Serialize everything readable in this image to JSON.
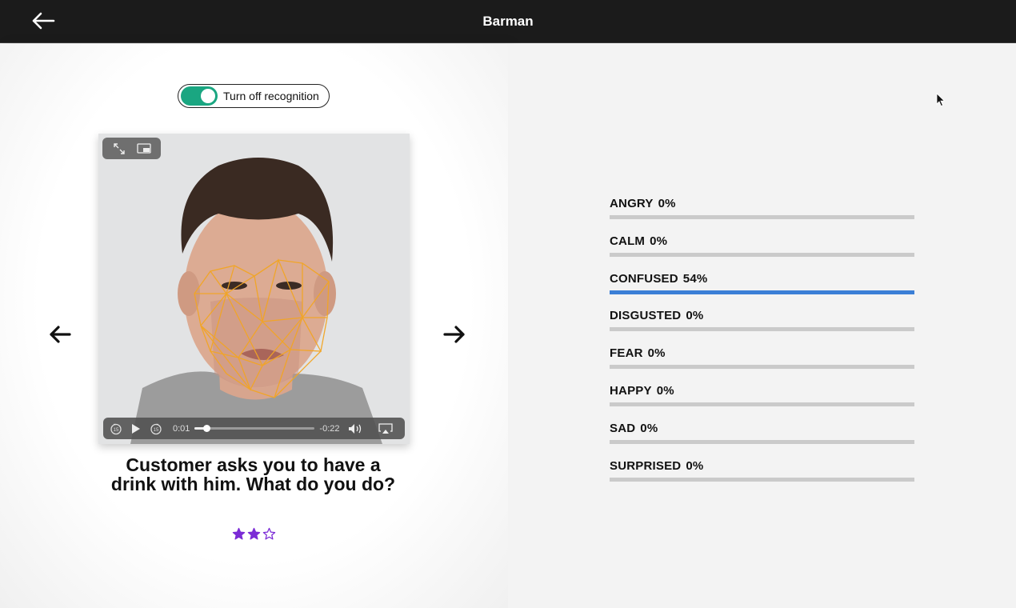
{
  "header": {
    "title": "Barman"
  },
  "toggle": {
    "label": "Turn off recognition",
    "on": true,
    "color": "#1aa681"
  },
  "video": {
    "current_time": "0:01",
    "remaining_time": "-0:22",
    "progress": 0.1
  },
  "question": "Customer asks you to have a drink with him. What do you do?",
  "rating": {
    "filled": 2,
    "total": 3,
    "color": "#7b2bd6"
  },
  "emotions": [
    {
      "name": "ANGRY",
      "value": "0%",
      "fraction": 0
    },
    {
      "name": "CALM",
      "value": "0%",
      "fraction": 0
    },
    {
      "name": "CONFUSED",
      "value": "54%",
      "fraction": 1.0
    },
    {
      "name": "DISGUSTED",
      "value": "0%",
      "fraction": 0
    },
    {
      "name": "FEAR",
      "value": "0%",
      "fraction": 0
    },
    {
      "name": "HAPPY",
      "value": "0%",
      "fraction": 0
    },
    {
      "name": "SAD",
      "value": "0%",
      "fraction": 0
    },
    {
      "name": "SURPRISED",
      "value": "0%",
      "fraction": 0
    }
  ],
  "colors": {
    "topbar": "#1b1b1b",
    "bar_fill": "#3b7fd6",
    "bar_track": "#cacaca",
    "mesh": "#f2a524"
  }
}
